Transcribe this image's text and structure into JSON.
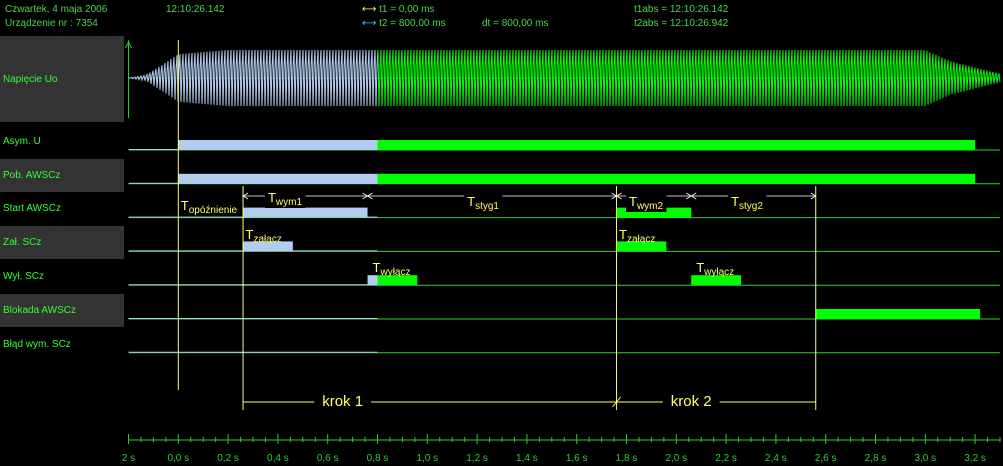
{
  "header": {
    "date": "Czwartek,  4  maja  2006",
    "device": "Urządzenie nr :  7354",
    "time": "12:10:26.142",
    "t1": "t1 = 0,00 ms",
    "t2": "t2 = 800,00 ms",
    "dt": "dt = 800,00 ms",
    "t1abs": "t1abs = 12:10:26.142",
    "t2abs": "t2abs = 12:10:26.942",
    "t1_marker_color": "#ffff33",
    "t2_marker_color": "#33ccff"
  },
  "colors": {
    "before": "#b3cdf0",
    "after": "#00ff00",
    "label": "#33ff33",
    "annot": "#ffff66",
    "grid": "#33cc33"
  },
  "chart_data": {
    "type": "line",
    "x_unit": "s",
    "xlim": [
      -0.2,
      3.3
    ],
    "cursor_t1": 0.0,
    "cursor_t2": 0.8,
    "ticks": [
      "2 s",
      "0,0 s",
      "0,2 s",
      "0,4 s",
      "0,6 s",
      "0,8 s",
      "1,0 s",
      "1,2 s",
      "1,4 s",
      "1,6 s",
      "1,8 s",
      "2,0 s",
      "2,2 s",
      "2,4 s",
      "2,6 s",
      "2,8 s",
      "3,0 s",
      "3,2 s"
    ],
    "tick_values": [
      -0.2,
      0.0,
      0.2,
      0.4,
      0.6,
      0.8,
      1.0,
      1.2,
      1.4,
      1.6,
      1.8,
      2.0,
      2.2,
      2.4,
      2.6,
      2.8,
      3.0,
      3.2
    ],
    "analog": {
      "label": "Napięcie Uo",
      "envelope": [
        [
          -0.2,
          0.0
        ],
        [
          -0.13,
          0.1
        ],
        [
          -0.05,
          0.55
        ],
        [
          0.0,
          0.85
        ],
        [
          0.2,
          1.0
        ],
        [
          3.0,
          1.0
        ],
        [
          3.1,
          0.6
        ],
        [
          3.3,
          0.15
        ]
      ]
    },
    "channels": [
      {
        "label": "Asym. U",
        "shaded": false,
        "segments": [
          [
            0.0,
            0.8
          ],
          [
            0.8,
            3.2
          ]
        ]
      },
      {
        "label": "Pob. AWSCz",
        "shaded": true,
        "segments": [
          [
            0.0,
            0.8
          ],
          [
            0.8,
            3.2
          ]
        ]
      },
      {
        "label": "Start AWSCz",
        "shaded": false,
        "segments": [
          [
            0.26,
            0.76
          ],
          [
            1.76,
            2.06
          ]
        ]
      },
      {
        "label": "Zał. SCz",
        "shaded": true,
        "segments": [
          [
            0.26,
            0.46
          ],
          [
            1.76,
            1.96
          ]
        ]
      },
      {
        "label": "Wył. SCz",
        "shaded": false,
        "segments": [
          [
            0.76,
            0.96
          ],
          [
            2.06,
            2.26
          ]
        ]
      },
      {
        "label": "Blokada AWSCz",
        "shaded": true,
        "segments": [
          [
            2.56,
            3.22
          ]
        ]
      },
      {
        "label": "Błąd wym. SCz",
        "shaded": false,
        "segments": []
      }
    ],
    "annotations": [
      {
        "main": "T",
        "sub": "opóźnienie"
      },
      {
        "main": "T",
        "sub": "wym1"
      },
      {
        "main": "T",
        "sub": "styg1"
      },
      {
        "main": "T",
        "sub": "wym2"
      },
      {
        "main": "T",
        "sub": "styg2"
      },
      {
        "main": "T",
        "sub": "załącz"
      },
      {
        "main": "T",
        "sub": "załącz"
      },
      {
        "main": "T",
        "sub": "wyłącz"
      },
      {
        "main": "T",
        "sub": "wyłącz"
      }
    ],
    "steps": [
      "krok 1",
      "krok 2"
    ]
  }
}
